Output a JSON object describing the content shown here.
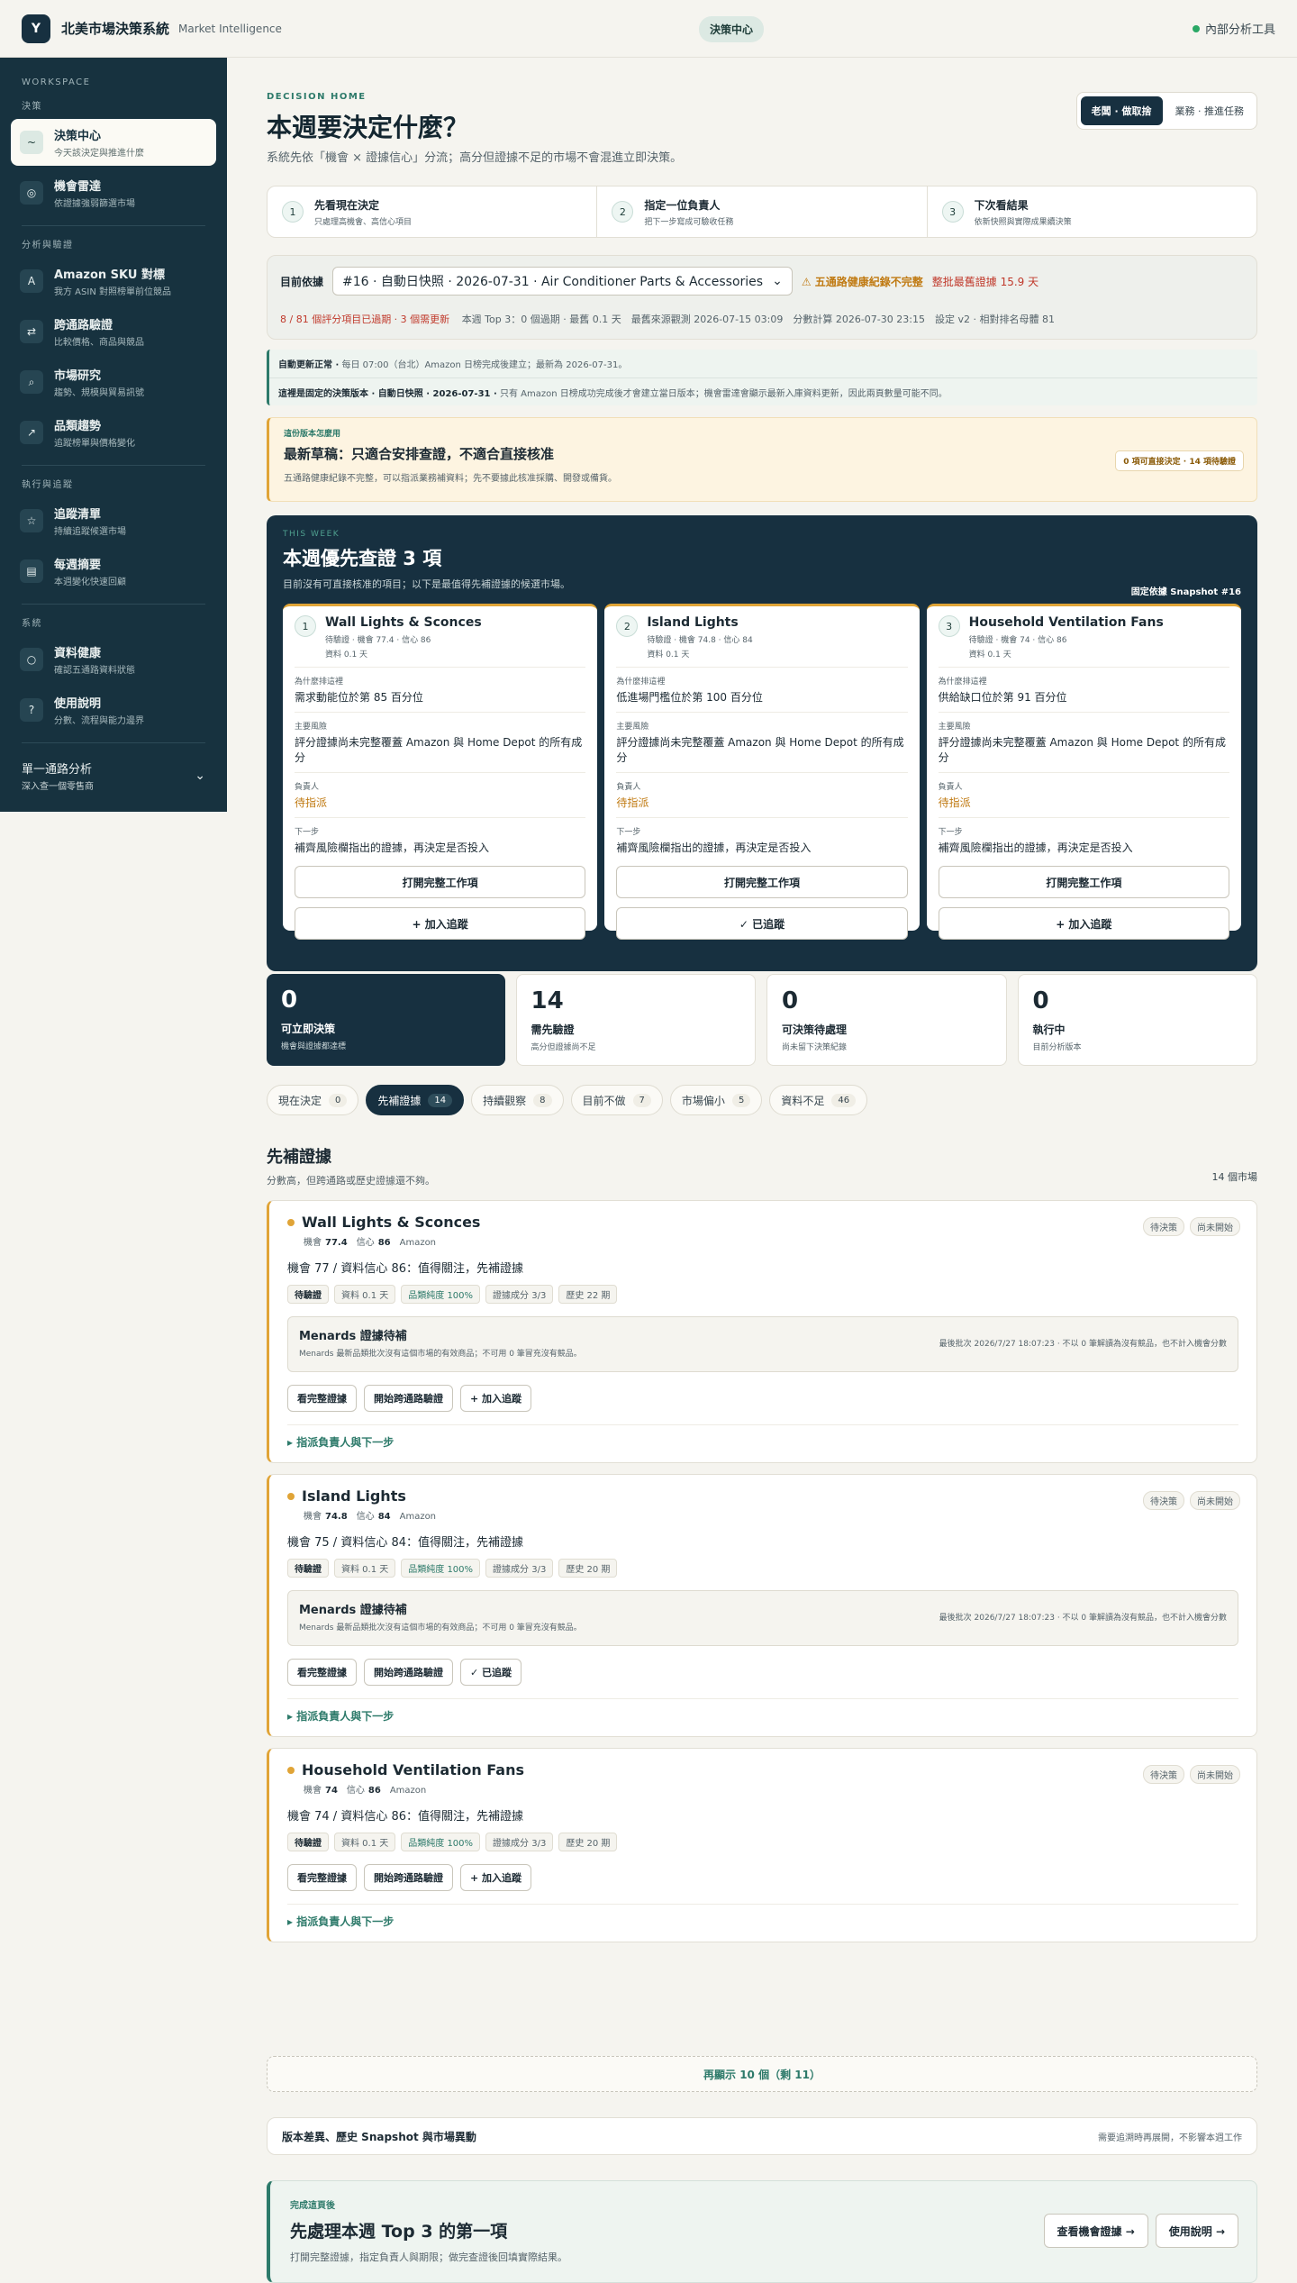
{
  "topbar": {
    "logo": "Y",
    "title": "北美市場決策系統",
    "subtitle": "Market Intelligence",
    "center_pill": "決策中心",
    "right_label": "內部分析工具"
  },
  "sidebar": {
    "workspace": "WORKSPACE",
    "sections": [
      {
        "title": "決策",
        "items": [
          {
            "label": "決策中心",
            "sub": "今天該決定與推進什麼",
            "icon": "~",
            "active": true
          },
          {
            "label": "機會雷達",
            "sub": "依證據強弱篩選市場",
            "icon": "◎"
          }
        ]
      },
      {
        "title": "分析與驗證",
        "items": [
          {
            "label": "Amazon SKU 對標",
            "sub": "我方 ASIN 對照榜單前位競品",
            "icon": "A"
          },
          {
            "label": "跨通路驗證",
            "sub": "比較價格、商品與競品",
            "icon": "⇄"
          },
          {
            "label": "市場研究",
            "sub": "趨勢、規模與貿易訊號",
            "icon": "⌕"
          },
          {
            "label": "品類趨勢",
            "sub": "追蹤榜單與價格變化",
            "icon": "↗"
          }
        ]
      },
      {
        "title": "執行與追蹤",
        "items": [
          {
            "label": "追蹤清單",
            "sub": "持續追蹤候選市場",
            "icon": "☆"
          },
          {
            "label": "每週摘要",
            "sub": "本週變化快速回顧",
            "icon": "▤"
          }
        ]
      },
      {
        "title": "系統",
        "items": [
          {
            "label": "資料健康",
            "sub": "確認五通路資料狀態",
            "icon": "○"
          },
          {
            "label": "使用說明",
            "sub": "分數、流程與能力邊界",
            "icon": "?"
          }
        ]
      }
    ],
    "footer": {
      "title": "單一通路分析",
      "sub": "深入查一個零售商",
      "chevron": "⌄"
    }
  },
  "header": {
    "eyebrow": "DECISION HOME",
    "title": "本週要決定什麼？",
    "desc": "系統先依「機會 × 證據信心」分流；高分但證據不足的市場不會混進立即決策。",
    "modes": [
      "老闆 · 做取捨",
      "業務 · 推進任務"
    ]
  },
  "steps": [
    {
      "n": "1",
      "title": "先看現在決定",
      "sub": "只處理高機會、高信心項目"
    },
    {
      "n": "2",
      "title": "指定一位負責人",
      "sub": "把下一步寫成可驗收任務"
    },
    {
      "n": "3",
      "title": "下次看結果",
      "sub": "依新快照與實際成果續決策"
    }
  ],
  "basis": {
    "label": "目前依據",
    "select": "#16 · 自動日快照 · 2026-07-31 · Air Conditioner Parts & Accessories",
    "warn": "⚠ 五通路健康紀錄不完整",
    "warn2": "整批最舊證據 15.9 天",
    "meta_red": "8 / 81 個評分項目已過期 · 3 個需更新",
    "meta": "本週 Top 3：0 個過期 · 最舊 0.1 天　最舊來源觀測 2026-07-15 03:09　分數計算 2026-07-30 23:15　設定 v2 · 相對排名母體 81"
  },
  "notice": {
    "l1b": "自動更新正常 ·",
    "l1": "每日 07:00（台北）Amazon 日榜完成後建立；最新為 2026-07-31。",
    "l2b": "這裡是固定的決策版本 · 自動日快照 · 2026-07-31 ·",
    "l2": "只有 Amazon 日榜成功完成後才會建立當日版本；機會雷達會顯示最新入庫資料更新，因此兩頁數量可能不同。"
  },
  "usage": {
    "eyebrow": "這份版本怎麼用",
    "title": "最新草稿：只適合安排查證，不適合直接核准",
    "desc": "五通路健康紀錄不完整，可以指派業務補資料；先不要據此核准採購、開發或備貨。",
    "badge": "0 項可直接決定 · 14 項待驗證"
  },
  "week": {
    "eyebrow": "THIS WEEK",
    "title": "本週優先查證 3 項",
    "sub": "目前沒有可直接核准的項目；以下是最值得先補證據的候選市場。",
    "snapshot": "固定依據 Snapshot #16",
    "cards": [
      {
        "n": "1",
        "name": "Wall Lights & Sconces",
        "meta": "待驗證 · 機會 77.4 · 信心 86",
        "age": "資料 0.1 天",
        "why_l": "為什麼排這裡",
        "why": "需求動能位於第 85 百分位",
        "risk_l": "主要風險",
        "risk": "評分證據尚未完整覆蓋 Amazon 與 Home Depot 的所有成分",
        "owner_l": "負責人",
        "owner": "待指派",
        "next_l": "下一步",
        "next": "補齊風險欄指出的證據，再決定是否投入",
        "b1": "打開完整工作項",
        "b2": "+ 加入追蹤"
      },
      {
        "n": "2",
        "name": "Island Lights",
        "meta": "待驗證 · 機會 74.8 · 信心 84",
        "age": "資料 0.1 天",
        "why_l": "為什麼排這裡",
        "why": "低進場門檻位於第 100 百分位",
        "risk_l": "主要風險",
        "risk": "評分證據尚未完整覆蓋 Amazon 與 Home Depot 的所有成分",
        "owner_l": "負責人",
        "owner": "待指派",
        "next_l": "下一步",
        "next": "補齊風險欄指出的證據，再決定是否投入",
        "b1": "打開完整工作項",
        "b2": "✓ 已追蹤"
      },
      {
        "n": "3",
        "name": "Household Ventilation Fans",
        "meta": "待驗證 · 機會 74 · 信心 86",
        "age": "資料 0.1 天",
        "why_l": "為什麼排這裡",
        "why": "供給缺口位於第 91 百分位",
        "risk_l": "主要風險",
        "risk": "評分證據尚未完整覆蓋 Amazon 與 Home Depot 的所有成分",
        "owner_l": "負責人",
        "owner": "待指派",
        "next_l": "下一步",
        "next": "補齊風險欄指出的證據，再決定是否投入",
        "b1": "打開完整工作項",
        "b2": "+ 加入追蹤"
      }
    ]
  },
  "stats": [
    {
      "num": "0",
      "label": "可立即決策",
      "sub": "機會與證據都達標",
      "dark": true
    },
    {
      "num": "14",
      "label": "需先驗證",
      "sub": "高分但證據尚不足"
    },
    {
      "num": "0",
      "label": "可決策待處理",
      "sub": "尚未留下決策紀錄"
    },
    {
      "num": "0",
      "label": "執行中",
      "sub": "目前分析版本"
    }
  ],
  "filters": [
    {
      "label": "現在決定",
      "count": "0"
    },
    {
      "label": "先補證據",
      "count": "14",
      "active": true
    },
    {
      "label": "持續觀察",
      "count": "8"
    },
    {
      "label": "目前不做",
      "count": "7"
    },
    {
      "label": "市場偏小",
      "count": "5"
    },
    {
      "label": "資料不足",
      "count": "46"
    }
  ],
  "section": {
    "title": "先補證據",
    "sub": "分數高，但跨通路或歷史證據還不夠。",
    "count": "14 個市場"
  },
  "candidates": [
    {
      "name": "Wall Lights & Sconces",
      "opp_l": "機會",
      "opp": "77.4",
      "conf_l": "信心",
      "conf": "86",
      "src": "Amazon",
      "b1": "待決策",
      "b2": "尚未開始",
      "summary": "機會 77 / 資料信心 86：值得關注，先補證據",
      "tags": [
        "待驗證",
        "資料 0.1 天",
        "品類純度 100%",
        "證據成分 3/3",
        "歷史 22 期"
      ],
      "menards": {
        "title": "Menards 證據待補",
        "desc": "Menards 最新品類批次沒有這個市場的有效商品；不可用 0 筆冒充沒有競品。",
        "right": "最後批次 2026/7/27 18:07:23 · 不以 0 筆解讀為沒有競品，也不計入機會分數"
      },
      "btns": [
        "看完整證據",
        "開始跨通路驗證",
        "+ 加入追蹤"
      ],
      "assign": "▸ 指派負責人與下一步"
    },
    {
      "name": "Island Lights",
      "opp_l": "機會",
      "opp": "74.8",
      "conf_l": "信心",
      "conf": "84",
      "src": "Amazon",
      "b1": "待決策",
      "b2": "尚未開始",
      "summary": "機會 75 / 資料信心 84：值得關注，先補證據",
      "tags": [
        "待驗證",
        "資料 0.1 天",
        "品類純度 100%",
        "證據成分 3/3",
        "歷史 20 期"
      ],
      "menards": {
        "title": "Menards 證據待補",
        "desc": "Menards 最新品類批次沒有這個市場的有效商品；不可用 0 筆冒充沒有競品。",
        "right": "最後批次 2026/7/27 18:07:23 · 不以 0 筆解讀為沒有競品，也不計入機會分數"
      },
      "btns": [
        "看完整證據",
        "開始跨通路驗證",
        "✓ 已追蹤"
      ],
      "assign": "▸ 指派負責人與下一步"
    },
    {
      "name": "Household Ventilation Fans",
      "opp_l": "機會",
      "opp": "74",
      "conf_l": "信心",
      "conf": "86",
      "src": "Amazon",
      "b1": "待決策",
      "b2": "尚未開始",
      "summary": "機會 74 / 資料信心 86：值得關注，先補證據",
      "tags": [
        "待驗證",
        "資料 0.1 天",
        "品類純度 100%",
        "證據成分 3/3",
        "歷史 20 期"
      ],
      "btns": [
        "看完整證據",
        "開始跨通路驗證",
        "+ 加入追蹤"
      ],
      "assign": "▸ 指派負責人與下一步"
    }
  ],
  "more": "再顯示 10 個（剩 11）",
  "version_bar": {
    "title": "版本差異、歷史 Snapshot 與市場異動",
    "right": "需要追溯時再展開，不影響本週工作"
  },
  "cta": {
    "eyebrow": "完成這頁後",
    "title": "先處理本週 Top 3 的第一項",
    "sub": "打開完整證據，指定負責人與期限；做完查證後回填實際結果。",
    "b1": "查看機會證據 →",
    "b2": "使用說明 →"
  }
}
